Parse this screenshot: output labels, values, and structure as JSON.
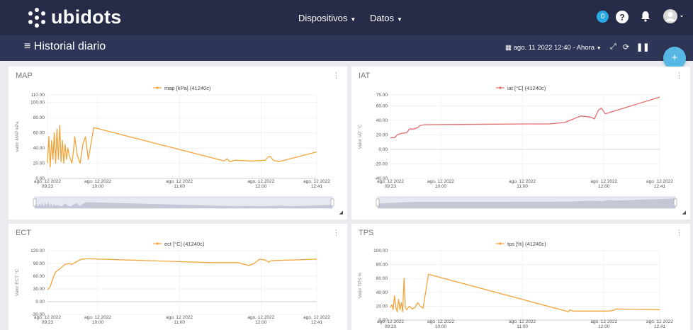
{
  "app": {
    "name": "ubidots"
  },
  "nav": [
    {
      "label": "Dispositivos"
    },
    {
      "label": "Datos"
    }
  ],
  "notifications": {
    "count": "0"
  },
  "header": {
    "title": "Historial diario",
    "date_range": "ago. 11 2022 12:40 - Ahora"
  },
  "icons": {
    "menu": "hamburger-icon",
    "help": "question-icon",
    "bell": "bell-icon",
    "avatar": "user-avatar",
    "calendar": "calendar-icon",
    "fullscreen": "expand-icon",
    "refresh": "refresh-icon",
    "pause": "pause-icon",
    "add": "plus-icon"
  },
  "colors": {
    "topbar": "#262b47",
    "subbar": "#2f3557",
    "accent": "#29a9e1",
    "orange": "#f2a43a",
    "red": "#e06c6c"
  },
  "cards": [
    {
      "title": "MAP",
      "menu": "⋮",
      "navigator": true
    },
    {
      "title": "IAT",
      "menu": "⋮",
      "navigator": true
    },
    {
      "title": "ECT",
      "menu": "⋮",
      "navigator": false
    },
    {
      "title": "TPS",
      "menu": "⋮",
      "navigator": false
    }
  ],
  "chart_data": [
    {
      "type": "line",
      "legend": "map [kPa] (41240c)",
      "ylabel": "valor MAP kPa",
      "color": "#f2a43a",
      "y_ticks": [
        "110.00",
        "100.00",
        "80.00",
        "60.00",
        "40.00",
        "20.00",
        "0.00"
      ],
      "y_tick_values": [
        110,
        100,
        80,
        60,
        40,
        20,
        0
      ],
      "ylim": [
        0,
        110
      ],
      "x_ticks": [
        [
          "ago. 12 2022",
          "09:23"
        ],
        [
          "ago. 12 2022",
          "10:00"
        ],
        [
          "ago. 12 2022",
          "11:00"
        ],
        [
          "ago. 12 2022",
          "12:00"
        ],
        [
          "ago. 12 2022",
          "12:41"
        ]
      ],
      "x_tick_values": [
        0,
        37,
        97,
        157,
        198
      ],
      "x": [
        0,
        1,
        2,
        3,
        4,
        5,
        6,
        7,
        8,
        9,
        10,
        11,
        12,
        13,
        14,
        15,
        16,
        17,
        18,
        19,
        20,
        22,
        24,
        26,
        28,
        30,
        34,
        130,
        132,
        134,
        138,
        150,
        160,
        162,
        164,
        166,
        170,
        198
      ],
      "y": [
        20,
        55,
        15,
        50,
        25,
        60,
        20,
        65,
        25,
        70,
        22,
        50,
        20,
        45,
        25,
        40,
        30,
        25,
        20,
        35,
        55,
        30,
        20,
        45,
        55,
        25,
        67,
        23,
        26,
        22,
        24,
        23,
        24,
        28,
        29,
        24,
        22,
        35
      ]
    },
    {
      "type": "line",
      "legend": "iat [°C] (41240c)",
      "ylabel": "Valor IAT °C",
      "color": "#e06c6c",
      "y_ticks": [
        "75.00",
        "60.00",
        "40.00",
        "20.00",
        "0.00",
        "-20.00",
        "-40.00"
      ],
      "y_tick_values": [
        75,
        60,
        40,
        20,
        0,
        -20,
        -40
      ],
      "ylim": [
        -40,
        75
      ],
      "x_ticks": [
        [
          "ago. 12 2022",
          "09:23"
        ],
        [
          "ago. 12 2022",
          "10:00"
        ],
        [
          "ago. 12 2022",
          "11:00"
        ],
        [
          "ago. 12 2022",
          "12:00"
        ],
        [
          "ago. 12 2022",
          "12:41"
        ]
      ],
      "x_tick_values": [
        0,
        37,
        97,
        157,
        198
      ],
      "x": [
        0,
        3,
        5,
        8,
        12,
        14,
        17,
        20,
        22,
        25,
        100,
        117,
        128,
        140,
        145,
        148,
        150,
        153,
        155,
        158,
        198
      ],
      "y": [
        16,
        16,
        20,
        22,
        23,
        28,
        28,
        30,
        33,
        34,
        35,
        35,
        37,
        46,
        45,
        44,
        42,
        54,
        57,
        49,
        72
      ]
    },
    {
      "type": "line",
      "legend": "ect [°C] (41240c)",
      "ylabel": "Valor ECT °C",
      "color": "#f2a43a",
      "y_ticks": [
        "120.00",
        "90.00",
        "60.00",
        "30.00",
        "0.00",
        "-30.00"
      ],
      "y_tick_values": [
        120,
        90,
        60,
        30,
        0,
        -30
      ],
      "ylim": [
        -30,
        120
      ],
      "x_ticks": [
        [
          "ago. 12 2022",
          "09:23"
        ],
        [
          "ago. 12 2022",
          "10:00"
        ],
        [
          "ago. 12 2022",
          "11:00"
        ],
        [
          "ago. 12 2022",
          "12:00"
        ],
        [
          "ago. 12 2022",
          "12:41"
        ]
      ],
      "x_tick_values": [
        0,
        37,
        97,
        157,
        198
      ],
      "x": [
        0,
        2,
        4,
        6,
        8,
        10,
        13,
        16,
        18,
        22,
        25,
        30,
        40,
        60,
        80,
        100,
        120,
        140,
        148,
        152,
        156,
        160,
        163,
        164,
        168,
        198
      ],
      "y": [
        28,
        35,
        55,
        70,
        75,
        80,
        88,
        90,
        88,
        95,
        100,
        101,
        100,
        98,
        96,
        94,
        92,
        92,
        85,
        90,
        100,
        98,
        93,
        96,
        97,
        100
      ]
    },
    {
      "type": "line",
      "legend": "tps [%] (41240c)",
      "ylabel": "Valor TPS %",
      "color": "#f2a43a",
      "y_ticks": [
        "100.00",
        "80.00",
        "60.00",
        "40.00",
        "20.00",
        "0.00"
      ],
      "y_tick_values": [
        100,
        80,
        60,
        40,
        20,
        0
      ],
      "ylim": [
        0,
        100
      ],
      "x_ticks": [
        [
          "ago. 12 2022",
          "09:23"
        ],
        [
          "ago. 12 2022",
          "10:00"
        ],
        [
          "ago. 12 2022",
          "11:00"
        ],
        [
          "ago. 12 2022",
          "12:00"
        ],
        [
          "ago. 12 2022",
          "12:41"
        ]
      ],
      "x_tick_values": [
        0,
        37,
        97,
        157,
        198
      ],
      "x": [
        0,
        1,
        2,
        3,
        4,
        5,
        6,
        7,
        8,
        9,
        10,
        11,
        12,
        14,
        16,
        18,
        20,
        22,
        24,
        28,
        131,
        132,
        134,
        138,
        150,
        160,
        164,
        166,
        198
      ],
      "y": [
        18,
        22,
        15,
        35,
        18,
        12,
        30,
        15,
        25,
        12,
        60,
        18,
        15,
        20,
        16,
        18,
        25,
        20,
        17,
        66,
        12,
        15,
        13,
        13,
        13,
        13,
        14,
        16,
        15
      ]
    }
  ]
}
